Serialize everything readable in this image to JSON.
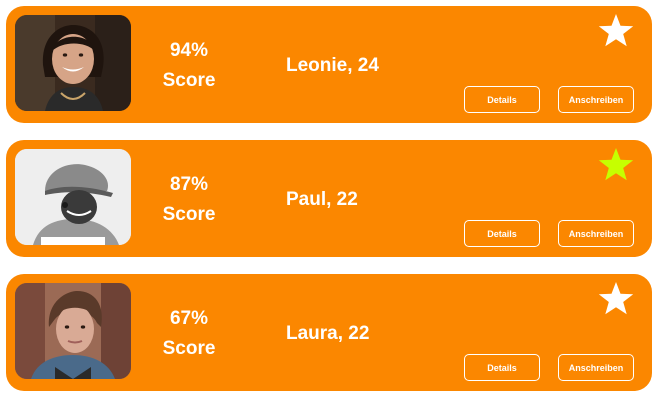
{
  "cards": [
    {
      "score_value": "94%",
      "score_label": "Score",
      "name": "Leonie, 24",
      "favorite": false,
      "star_color": "#ffffff",
      "details_label": "Details",
      "message_label": "Anschreiben"
    },
    {
      "score_value": "87%",
      "score_label": "Score",
      "name": "Paul, 22",
      "favorite": true,
      "star_color": "#c6ff00",
      "details_label": "Details",
      "message_label": "Anschreiben"
    },
    {
      "score_value": "67%",
      "score_label": "Score",
      "name": "Laura, 22",
      "favorite": false,
      "star_color": "#ffffff",
      "details_label": "Details",
      "message_label": "Anschreiben"
    }
  ],
  "colors": {
    "card_background": "#fb8700",
    "text": "#ffffff",
    "star_default": "#ffffff",
    "star_favorite": "#c6ff00"
  },
  "icons": {
    "favorite": "star-icon"
  }
}
